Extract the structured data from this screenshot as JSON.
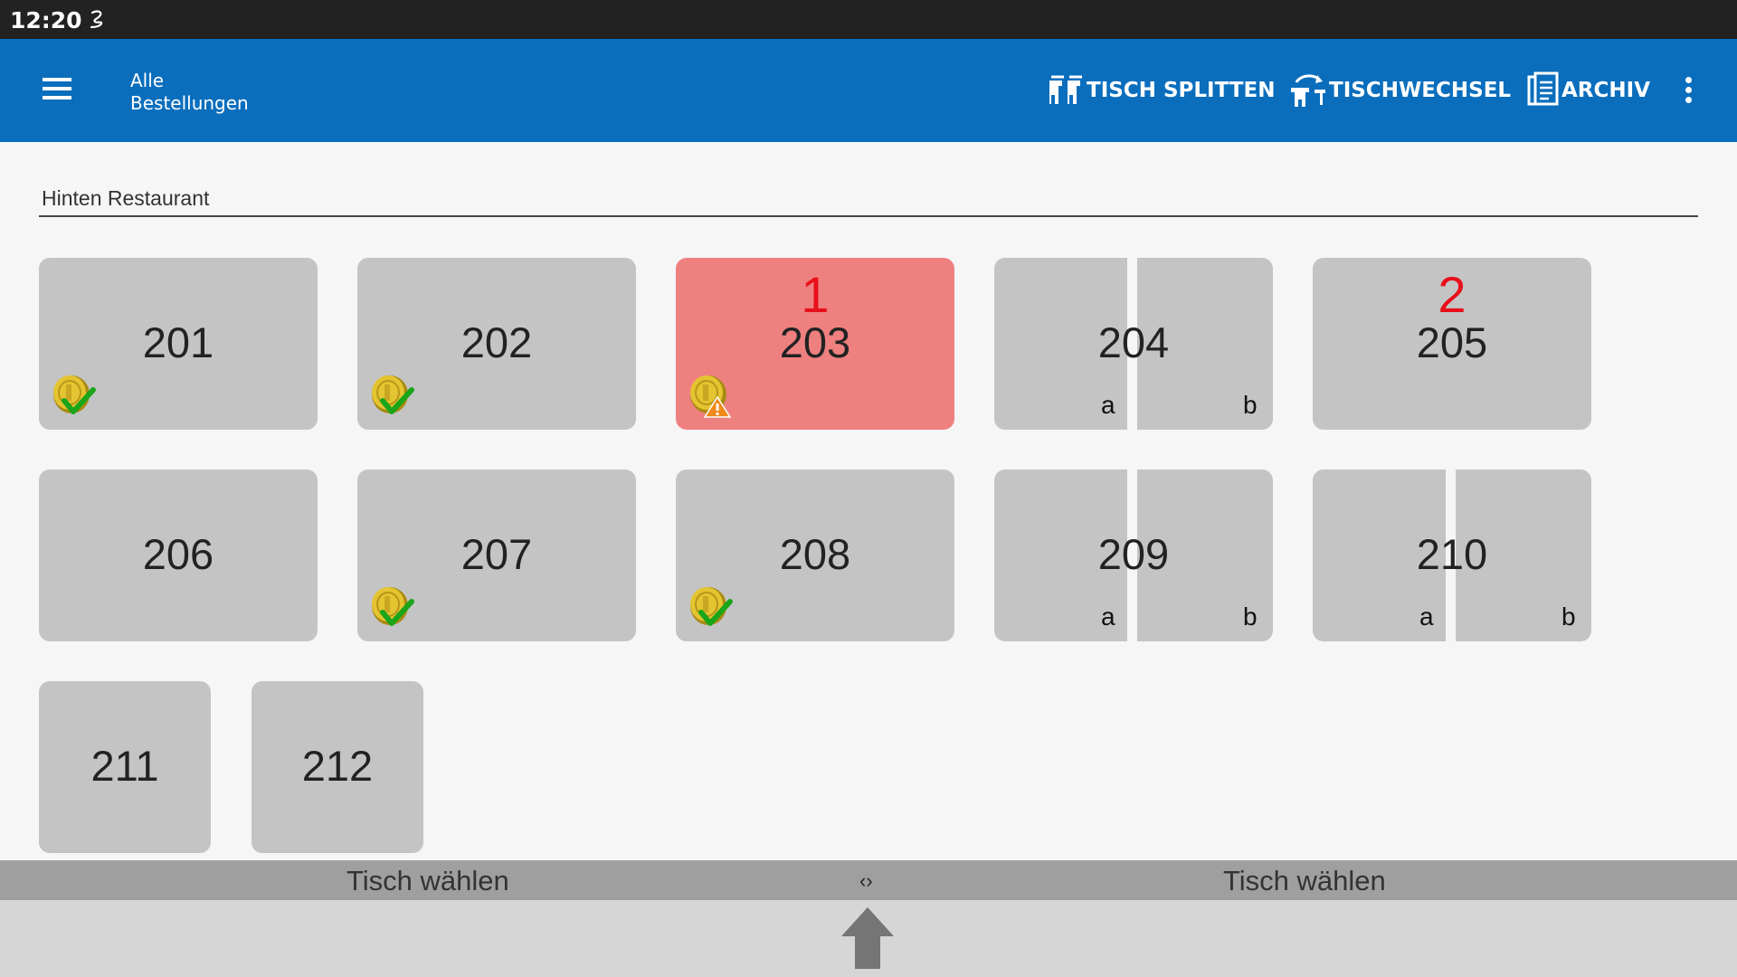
{
  "status_bar": {
    "time": "12:20",
    "icon": "handwriting-icon"
  },
  "app_bar": {
    "title_line1": "Alle",
    "title_line2": "Bestellungen",
    "menu_icon": "menu-icon",
    "actions": {
      "split": {
        "label": "TISCH SPLITTEN",
        "icon": "table-split-icon"
      },
      "change": {
        "label": "TISCHWECHSEL",
        "icon": "table-change-icon"
      },
      "archive": {
        "label": "ARCHIV",
        "icon": "archive-icon"
      }
    },
    "overflow_icon": "more-vert-icon"
  },
  "area": {
    "label": "Hinten Restaurant"
  },
  "tables": [
    {
      "number": "201",
      "status": "paid",
      "badge": "",
      "split": false,
      "sub_left": "",
      "sub_right": ""
    },
    {
      "number": "202",
      "status": "paid",
      "badge": "",
      "split": false,
      "sub_left": "",
      "sub_right": ""
    },
    {
      "number": "203",
      "status": "warning",
      "badge": "1",
      "split": false,
      "sub_left": "",
      "sub_right": ""
    },
    {
      "number": "204",
      "status": "",
      "badge": "",
      "split": true,
      "sub_left": "a",
      "sub_right": "b"
    },
    {
      "number": "205",
      "status": "",
      "badge": "2",
      "split": false,
      "sub_left": "",
      "sub_right": ""
    },
    {
      "number": "206",
      "status": "",
      "badge": "",
      "split": false,
      "sub_left": "",
      "sub_right": ""
    },
    {
      "number": "207",
      "status": "paid",
      "badge": "",
      "split": false,
      "sub_left": "",
      "sub_right": ""
    },
    {
      "number": "208",
      "status": "paid",
      "badge": "",
      "split": false,
      "sub_left": "",
      "sub_right": ""
    },
    {
      "number": "209",
      "status": "",
      "badge": "",
      "split": true,
      "sub_left": "a",
      "sub_right": "b"
    },
    {
      "number": "210",
      "status": "",
      "badge": "",
      "split": true,
      "sub_left": "a",
      "sub_right": "b"
    },
    {
      "number": "211",
      "status": "",
      "badge": "",
      "split": false,
      "sub_left": "",
      "sub_right": ""
    },
    {
      "number": "212",
      "status": "",
      "badge": "",
      "split": false,
      "sub_left": "",
      "sub_right": ""
    }
  ],
  "footer": {
    "left_label": "Tisch wählen",
    "swap_symbol": "‹›",
    "right_label": "Tisch wählen",
    "up_icon": "arrow-up-icon"
  },
  "colors": {
    "app_bar": "#0a6ebd",
    "status_bar": "#222222",
    "tile": "#c4c4c4",
    "tile_alert": "#ef8080",
    "badge": "#e8101a"
  }
}
